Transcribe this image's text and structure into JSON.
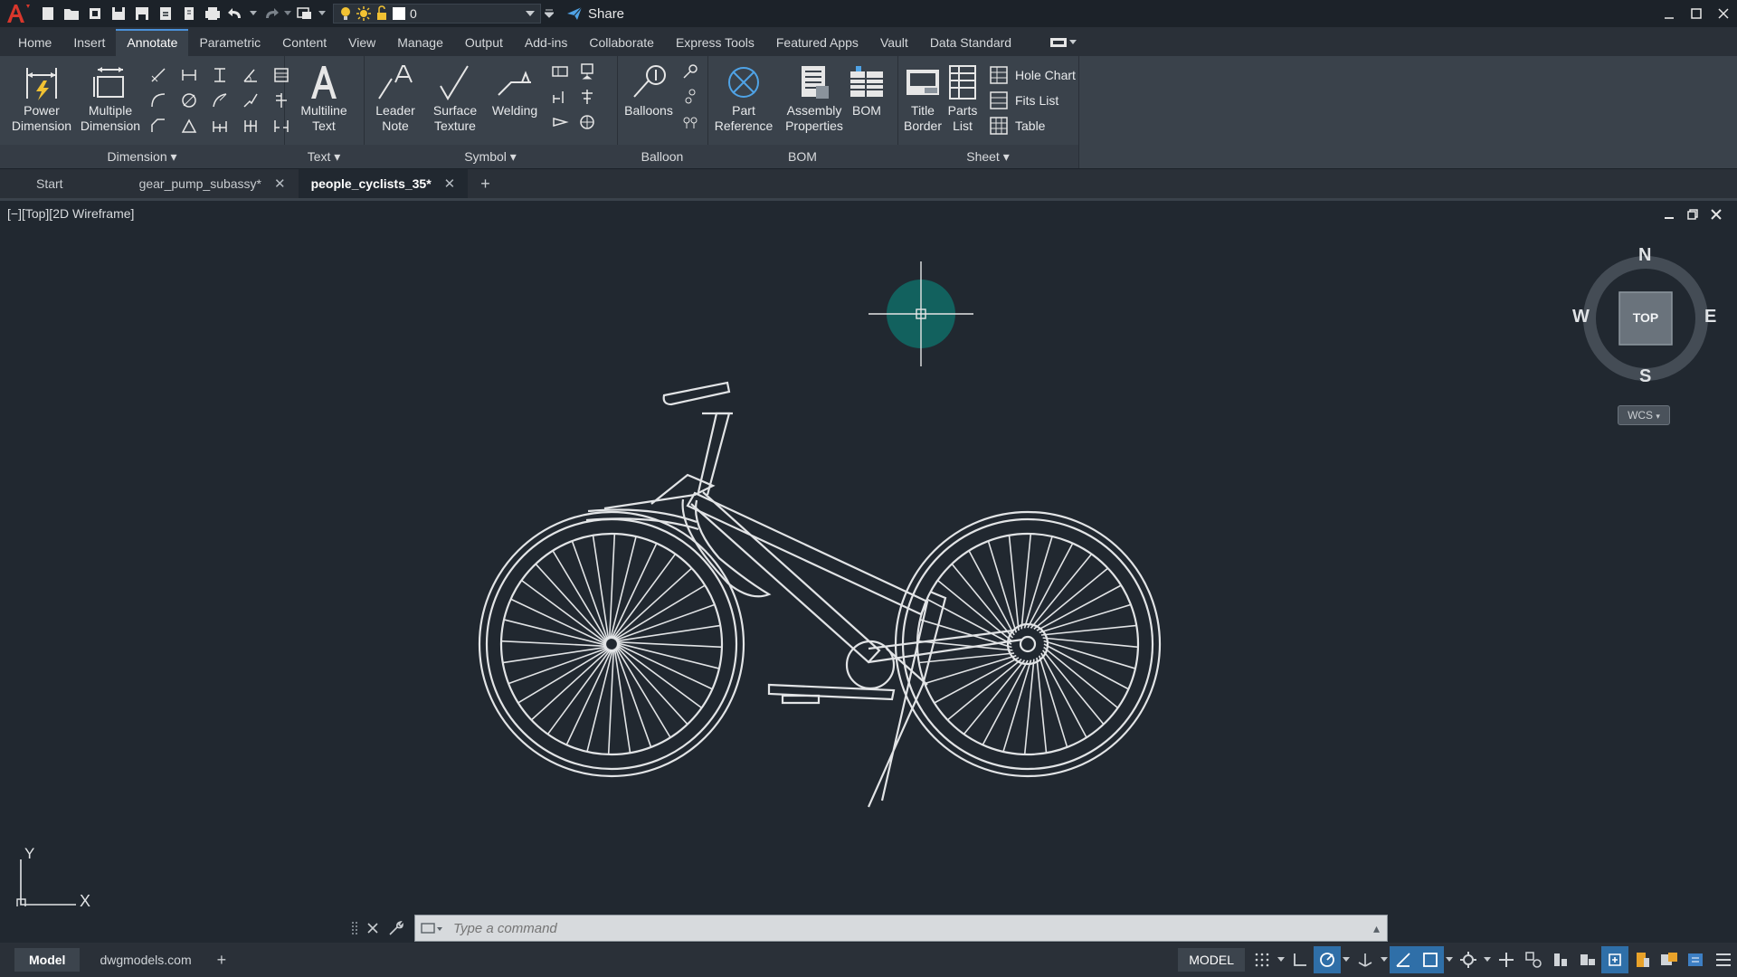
{
  "app": {
    "quick_access_layer_value": "0",
    "share_label": "Share"
  },
  "ribbon_tabs": [
    "Home",
    "Insert",
    "Annotate",
    "Parametric",
    "Content",
    "View",
    "Manage",
    "Output",
    "Add-ins",
    "Collaborate",
    "Express Tools",
    "Featured Apps",
    "Vault",
    "Data Standard"
  ],
  "active_ribbon_tab": "Annotate",
  "panels": {
    "dimension": {
      "title": "Dimension",
      "power_dimension": "Power\nDimension",
      "multiple_dimension": "Multiple\nDimension"
    },
    "text": {
      "title": "Text",
      "multiline_text": "Multiline\nText"
    },
    "symbol": {
      "title": "Symbol",
      "leader_note": "Leader\nNote",
      "surface_texture": "Surface\nTexture",
      "welding": "Welding"
    },
    "balloon": {
      "title": "Balloon",
      "balloons": "Balloons"
    },
    "bom": {
      "title": "BOM",
      "part_reference": "Part\nReference",
      "assembly_properties": "Assembly\nProperties",
      "bom": "BOM"
    },
    "sheet": {
      "title": "Sheet",
      "title_border": "Title\nBorder",
      "parts_list": "Parts\nList",
      "hole_chart": "Hole Chart",
      "fits_list": "Fits List",
      "table": "Table"
    }
  },
  "file_tabs": [
    {
      "label": "Start"
    },
    {
      "label": "gear_pump_subassy*"
    },
    {
      "label": "people_cyclists_35*"
    }
  ],
  "viewport": {
    "label": "[−][Top][2D Wireframe]"
  },
  "viewcube": {
    "north": "N",
    "south": "S",
    "east": "E",
    "west": "W",
    "face": "TOP",
    "wcs": "WCS"
  },
  "ucs": {
    "x": "X",
    "y": "Y"
  },
  "command": {
    "placeholder": "Type a command"
  },
  "layouts": [
    {
      "label": "Model"
    },
    {
      "label": "dwgmodels.com"
    }
  ],
  "status": {
    "model": "MODEL"
  }
}
